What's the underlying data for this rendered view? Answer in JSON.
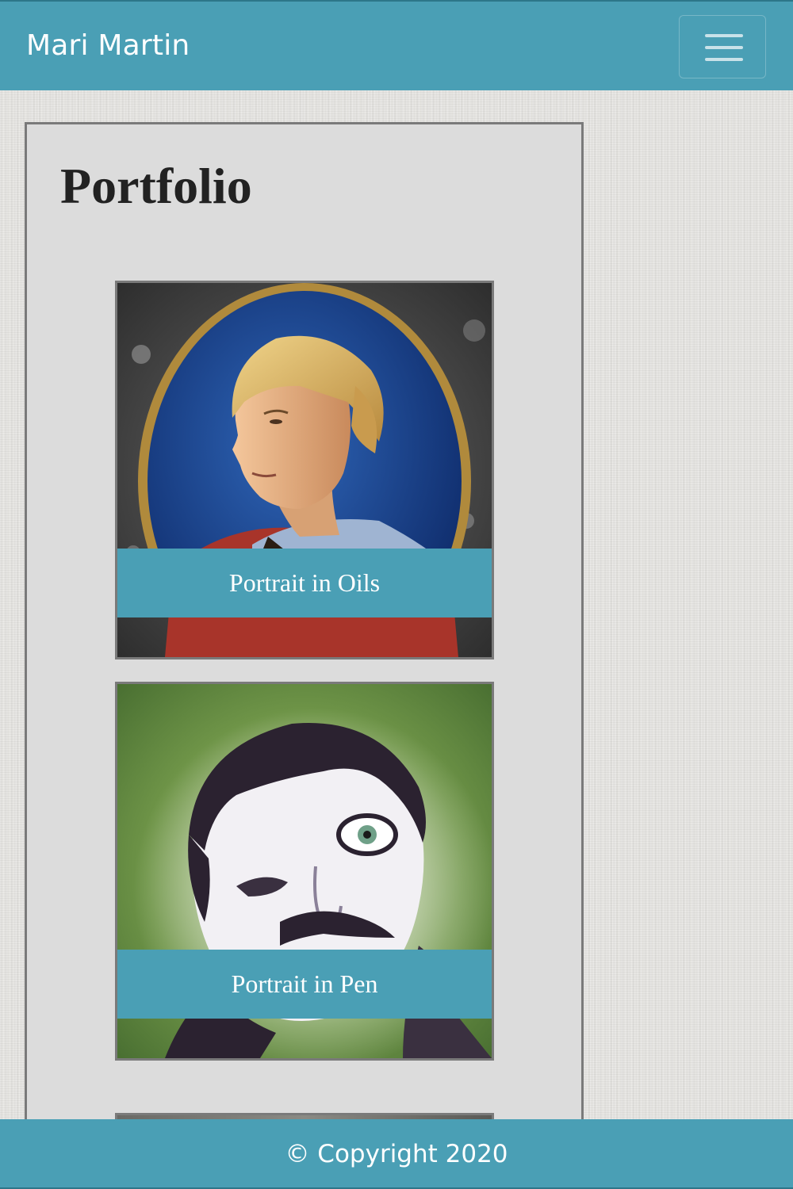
{
  "navbar": {
    "brand": "Mari Martin",
    "toggle_icon": "hamburger-menu-icon"
  },
  "main": {
    "title": "Portfolio",
    "cards": [
      {
        "caption": "Portrait in Oils"
      },
      {
        "caption": "Portrait in Pen"
      },
      {
        "caption": ""
      }
    ]
  },
  "footer": {
    "copyright": "© Copyright 2020"
  },
  "colors": {
    "accent": "#4a9fb5",
    "panel": "#dcdcdc",
    "border": "#7a7a7a",
    "heading": "#222222"
  }
}
